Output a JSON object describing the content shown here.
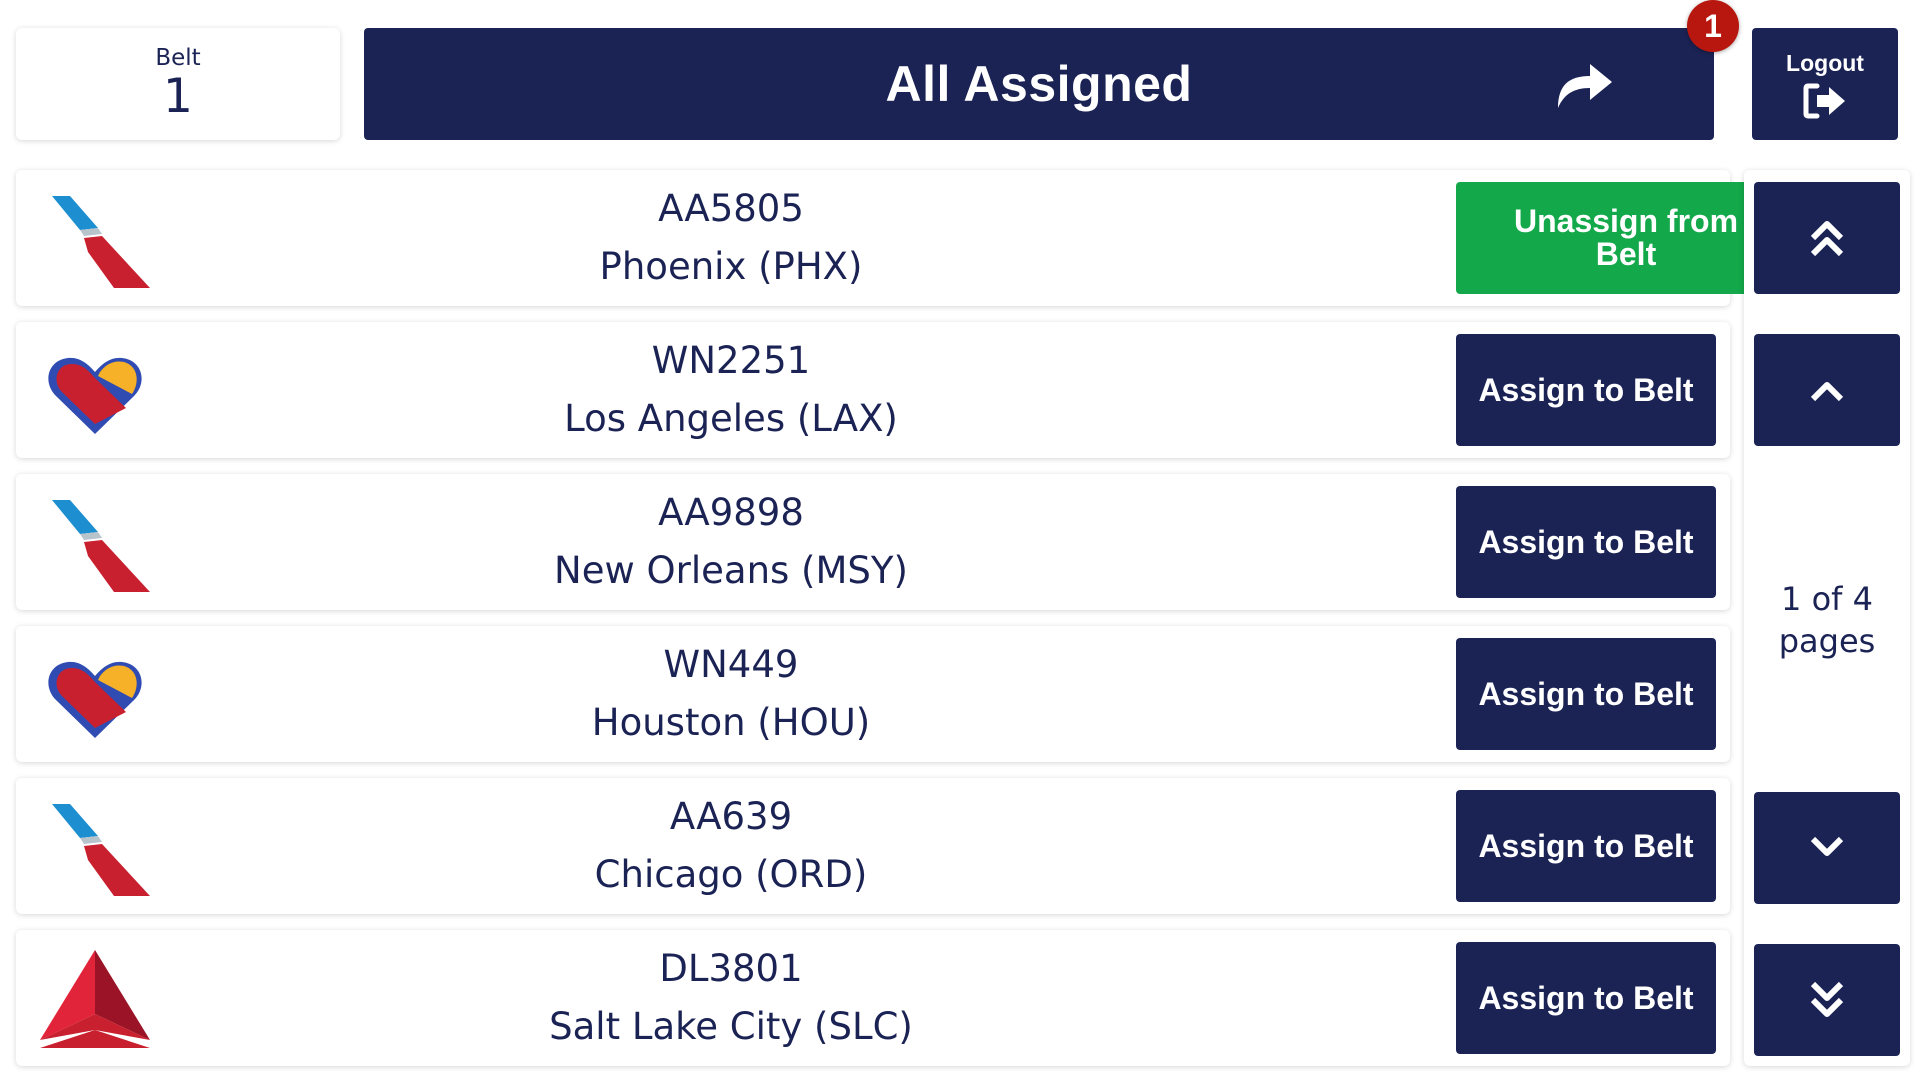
{
  "belt": {
    "label": "Belt",
    "number": "1"
  },
  "header": {
    "title": "All Assigned",
    "badge_count": "1",
    "icon": "share-arrow-icon"
  },
  "logout": {
    "label": "Logout",
    "icon": "sign-out-icon"
  },
  "flights": [
    {
      "code": "AA5805",
      "city": "Phoenix (PHX)",
      "airline_logo": "american-airlines-logo",
      "action": "Unassign from Belt",
      "action_state": "assigned"
    },
    {
      "code": "WN2251",
      "city": "Los Angeles (LAX)",
      "airline_logo": "southwest-airlines-logo",
      "action": "Assign to Belt",
      "action_state": "unassigned"
    },
    {
      "code": "AA9898",
      "city": "New Orleans (MSY)",
      "airline_logo": "american-airlines-logo",
      "action": "Assign to Belt",
      "action_state": "unassigned"
    },
    {
      "code": "WN449",
      "city": "Houston (HOU)",
      "airline_logo": "southwest-airlines-logo",
      "action": "Assign to Belt",
      "action_state": "unassigned"
    },
    {
      "code": "AA639",
      "city": "Chicago (ORD)",
      "airline_logo": "american-airlines-logo",
      "action": "Assign to Belt",
      "action_state": "unassigned"
    },
    {
      "code": "DL3801",
      "city": "Salt Lake City (SLC)",
      "airline_logo": "delta-airlines-logo",
      "action": "Assign to Belt",
      "action_state": "unassigned"
    }
  ],
  "pagination": {
    "page_line1": "1 of 4",
    "page_line2": "pages",
    "buttons": [
      "first-page-icon",
      "previous-page-icon",
      "next-page-icon",
      "last-page-icon"
    ]
  },
  "colors": {
    "navy": "#1b2355",
    "green": "#13a84a",
    "badge_red": "#b7170f"
  }
}
